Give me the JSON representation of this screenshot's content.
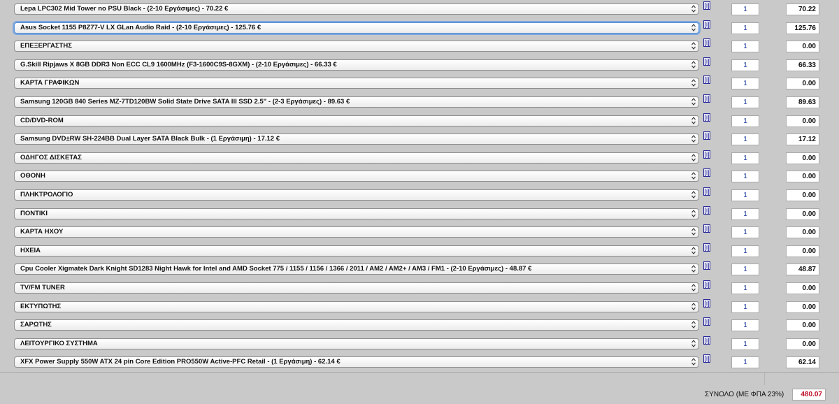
{
  "rows": [
    {
      "product": "Lepa LPC302 Mid Tower no PSU Black - (2-10 Εργάσιμες) - 70.22 €",
      "qty": "1",
      "price": "70.22"
    },
    {
      "product": "Asus Socket 1155 P8Z77-V LX GLan Audio Raid - (2-10 Εργάσιμες) - 125.76 €",
      "qty": "1",
      "price": "125.76"
    },
    {
      "product": "ΕΠΕΞΕΡΓΑΣΤΗΣ",
      "qty": "1",
      "price": "0.00"
    },
    {
      "product": "G.Skill Ripjaws X 8GB DDR3 Non ECC CL9 1600MHz (F3-1600C9S-8GXM) - (2-10 Εργάσιμες) - 66.33 €",
      "qty": "1",
      "price": "66.33"
    },
    {
      "product": "ΚΑΡΤΑ ΓΡΑΦΙΚΩΝ",
      "qty": "1",
      "price": "0.00"
    },
    {
      "product": "Samsung 120GB 840 Series MZ-7TD120BW Solid State Drive SATA III SSD 2.5\" - (2-3 Εργάσιμες) - 89.63 €",
      "qty": "1",
      "price": "89.63"
    },
    {
      "product": "CD/DVD-ROM",
      "qty": "1",
      "price": "0.00"
    },
    {
      "product": "Samsung DVD±RW SH-224BB Dual Layer SATA Black Bulk - (1 Εργάσιμη) - 17.12 €",
      "qty": "1",
      "price": "17.12"
    },
    {
      "product": "ΟΔΗΓΟΣ ΔΙΣΚΕΤΑΣ",
      "qty": "1",
      "price": "0.00"
    },
    {
      "product": "ΟΘΟΝΗ",
      "qty": "1",
      "price": "0.00"
    },
    {
      "product": "ΠΛΗΚΤΡΟΛΟΓΙΟ",
      "qty": "1",
      "price": "0.00"
    },
    {
      "product": "ΠΟΝΤΙΚΙ",
      "qty": "1",
      "price": "0.00"
    },
    {
      "product": "ΚΑΡΤΑ ΗΧΟΥ",
      "qty": "1",
      "price": "0.00"
    },
    {
      "product": "ΗΧΕΙΑ",
      "qty": "1",
      "price": "0.00"
    },
    {
      "product": "Cpu Cooler Xigmatek Dark Knight SD1283 Night Hawk for Intel and AMD Socket 775 / 1155 / 1156 / 1366 / 2011 / AM2 / AM2+ / AM3 / FM1 - (2-10 Εργάσιμες) - 48.87 €",
      "qty": "1",
      "price": "48.87"
    },
    {
      "product": "TV/FM TUNER",
      "qty": "1",
      "price": "0.00"
    },
    {
      "product": "ΕΚΤΥΠΩΤΗΣ",
      "qty": "1",
      "price": "0.00"
    },
    {
      "product": "ΣΑΡΩΤΗΣ",
      "qty": "1",
      "price": "0.00"
    },
    {
      "product": "ΛΕΙΤΟΥΡΓΙΚΟ ΣΥΣΤΗΜΑ",
      "qty": "1",
      "price": "0.00"
    },
    {
      "product": "XFX Power Supply 550W ATX 24 pin Core Edition PRO550W Active-PFC Retail - (1 Εργάσιμη) - 62.14 €",
      "qty": "1",
      "price": "62.14"
    }
  ],
  "info_icon": {
    "glyph": "[i]",
    "icon": "info-icon"
  },
  "select_arrow": {
    "glyph": "⌃⌄",
    "icon": "updown-arrows-icon"
  },
  "total": {
    "label": "ΣΥΝΟΛΟ (ΜΕ ΦΠΑ 23%)",
    "value": "480.07"
  },
  "colors": {
    "background": "#c9c9c9",
    "total_value": "#c0102a",
    "qty_text": "#1a3a9a",
    "info_icon": "#2a2a9a"
  }
}
